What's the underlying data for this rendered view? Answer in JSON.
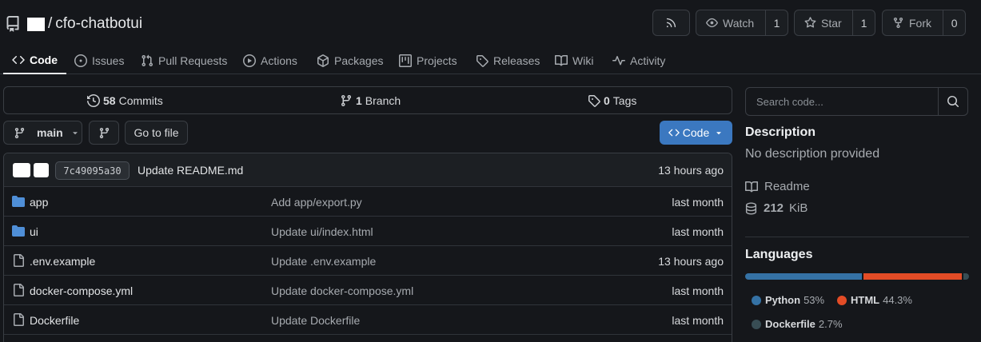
{
  "repo": {
    "name": "cfo-chatbotui",
    "separator": "/"
  },
  "header_buttons": {
    "watch": {
      "label": "Watch",
      "count": "1"
    },
    "star": {
      "label": "Star",
      "count": "1"
    },
    "fork": {
      "label": "Fork",
      "count": "0"
    }
  },
  "tabs": [
    {
      "label": "Code",
      "icon": "code-icon",
      "active": true
    },
    {
      "label": "Issues",
      "icon": "issue-icon"
    },
    {
      "label": "Pull Requests",
      "icon": "pull-request-icon"
    },
    {
      "label": "Actions",
      "icon": "play-icon"
    },
    {
      "label": "Packages",
      "icon": "package-icon"
    },
    {
      "label": "Projects",
      "icon": "project-icon"
    },
    {
      "label": "Releases",
      "icon": "tag-icon"
    },
    {
      "label": "Wiki",
      "icon": "book-icon"
    },
    {
      "label": "Activity",
      "icon": "pulse-icon"
    }
  ],
  "stats": {
    "commits": {
      "count": "58",
      "label": "Commits"
    },
    "branches": {
      "count": "1",
      "label": "Branch"
    },
    "tags": {
      "count": "0",
      "label": "Tags"
    }
  },
  "branch": {
    "name": "main",
    "go_to_file": "Go to file",
    "code_button": "Code"
  },
  "latest_commit": {
    "sha": "7c49095a30",
    "message": "Update README.md",
    "time": "13 hours ago"
  },
  "files": [
    {
      "type": "folder",
      "name": "app",
      "message": "Add app/export.py",
      "time": "last month"
    },
    {
      "type": "folder",
      "name": "ui",
      "message": "Update ui/index.html",
      "time": "last month"
    },
    {
      "type": "file",
      "name": ".env.example",
      "message": "Update .env.example",
      "time": "13 hours ago"
    },
    {
      "type": "file",
      "name": "docker-compose.yml",
      "message": "Update docker-compose.yml",
      "time": "last month"
    },
    {
      "type": "file",
      "name": "Dockerfile",
      "message": "Update Dockerfile",
      "time": "last month"
    }
  ],
  "sidebar": {
    "search_placeholder": "Search code...",
    "description_title": "Description",
    "description_text": "No description provided",
    "readme": "Readme",
    "size_value": "212",
    "size_unit": "KiB",
    "languages_title": "Languages",
    "languages": [
      {
        "name": "Python",
        "percent": "53%",
        "fraction": 0.53,
        "color": "#3572a5"
      },
      {
        "name": "HTML",
        "percent": "44.3%",
        "fraction": 0.443,
        "color": "#e34c26"
      },
      {
        "name": "Dockerfile",
        "percent": "2.7%",
        "fraction": 0.027,
        "color": "#384d54"
      }
    ]
  },
  "colors": {
    "accent": "#3b78c0",
    "background": "#15171b",
    "border": "#3a3e44",
    "folder": "#4f8fd8"
  }
}
